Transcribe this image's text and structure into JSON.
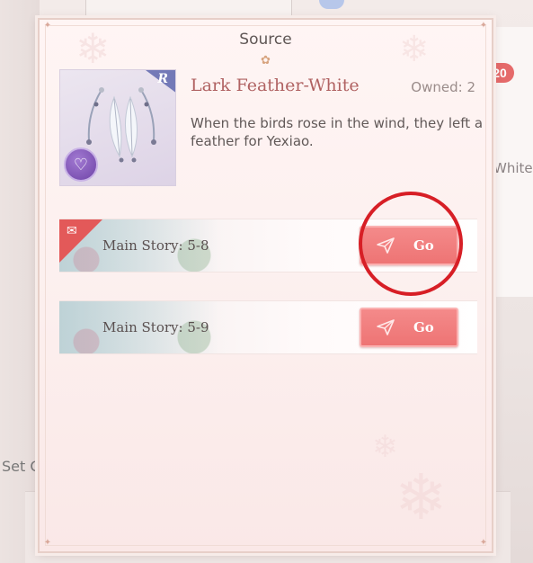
{
  "dialog": {
    "title": "Source"
  },
  "item": {
    "name": "Lark Feather-White",
    "owned_label": "Owned: 2",
    "rarity": "R",
    "description": "When the birds rose in the wind, they left a feather for Yexiao."
  },
  "sources": [
    {
      "label": "Main Story: 5-8",
      "button_label": "Go",
      "is_new": true
    },
    {
      "label": "Main Story: 5-9",
      "button_label": "Go",
      "is_new": false
    }
  ],
  "background": {
    "badge_count": "20",
    "right_text": "White",
    "left_text": "Set C"
  },
  "colors": {
    "go_button": "#ee7474",
    "item_name": "#b06262",
    "rarity_tag": "#7379b7",
    "highlight_ring": "#d71f26"
  }
}
